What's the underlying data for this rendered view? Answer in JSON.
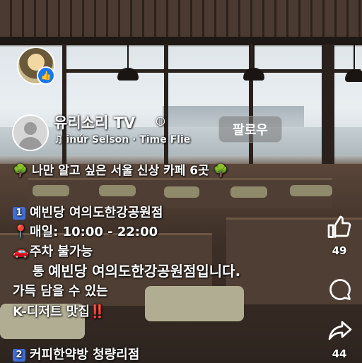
{
  "caption": {
    "title": "🌳 나만 알고 싶은 서울 신상 카페 6곳 🌳",
    "item1_number": "1",
    "item1_name": "예빈당 여의도한강공원점",
    "item1_hours_icon": "📍",
    "item1_hours": "매일: 10:00 - 22:00",
    "item1_parking_icon": "🚗",
    "item1_parking": "주차 불가능",
    "item1_desc_start": "통",
    "subtitle": "예빈당 여의도한강공원점입니다.",
    "desc_line2": "가득 담을 수 있는",
    "desc_line3": "K-디저트 맛집‼️",
    "item2_number": "2",
    "item2_name": "커피한약방 청량리점"
  },
  "channel": {
    "name": "유리소리 TV",
    "music": "♫ inúr Selson · Time Flie",
    "follow_label": "팔로우"
  },
  "actions": {
    "like_count": "49",
    "comment_count": "",
    "share_count": "44"
  },
  "icons": {
    "like": "thumbs-up-icon",
    "comment": "comment-icon",
    "share": "share-icon",
    "music": "music-note-icon"
  }
}
